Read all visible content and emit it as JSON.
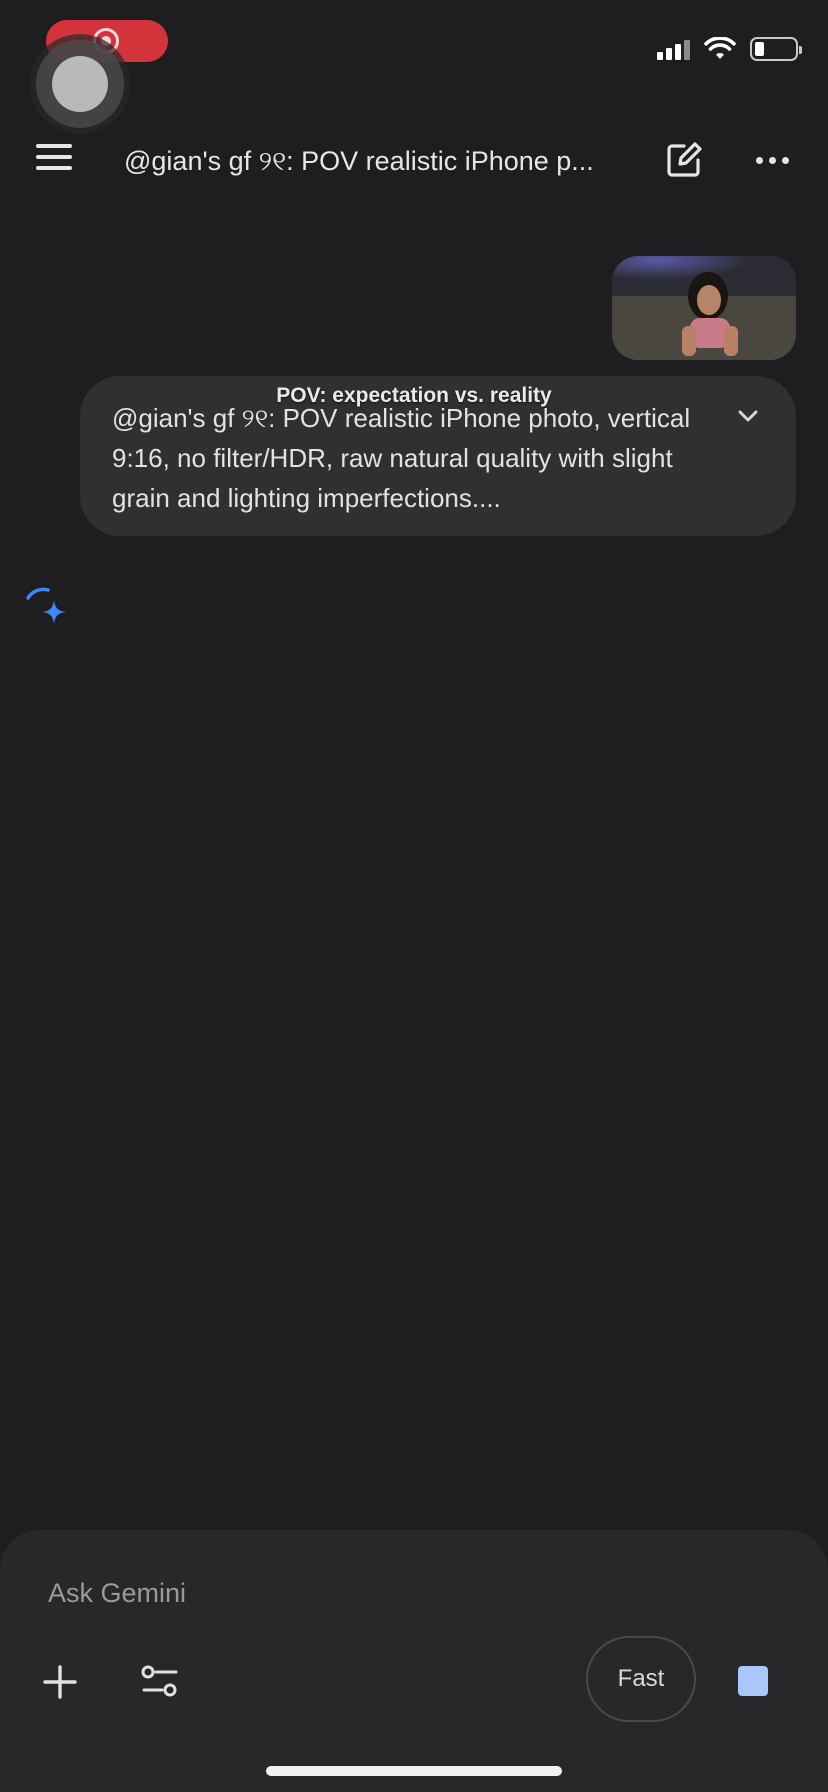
{
  "header": {
    "title": "@gian's gf ୨୧: POV realistic iPhone p..."
  },
  "conversation": {
    "overlay_caption": "POV: expectation vs. reality",
    "prompt_text": "@gian's gf ୨୧: POV realistic iPhone photo, vertical 9:16, no filter/HDR, raw natural quality with slight grain and lighting imperfections...."
  },
  "composer": {
    "placeholder": "Ask Gemini",
    "mode_label": "Fast"
  },
  "icons": {
    "menu": "hamburger-menu-icon",
    "edit": "new-chat-edit-icon",
    "more": "more-horizontal-icon",
    "expand": "chevron-down-icon",
    "spark": "gemini-spark-icon",
    "plus": "plus-icon",
    "tools": "tools-sliders-icon",
    "stop": "stop-square-icon"
  },
  "colors": {
    "background": "#1e1e21",
    "bubble": "#303033",
    "composer": "#28282b",
    "accent": "#a8c7fa",
    "spark_blue": "#4285f4",
    "recording": "#d3343c"
  }
}
